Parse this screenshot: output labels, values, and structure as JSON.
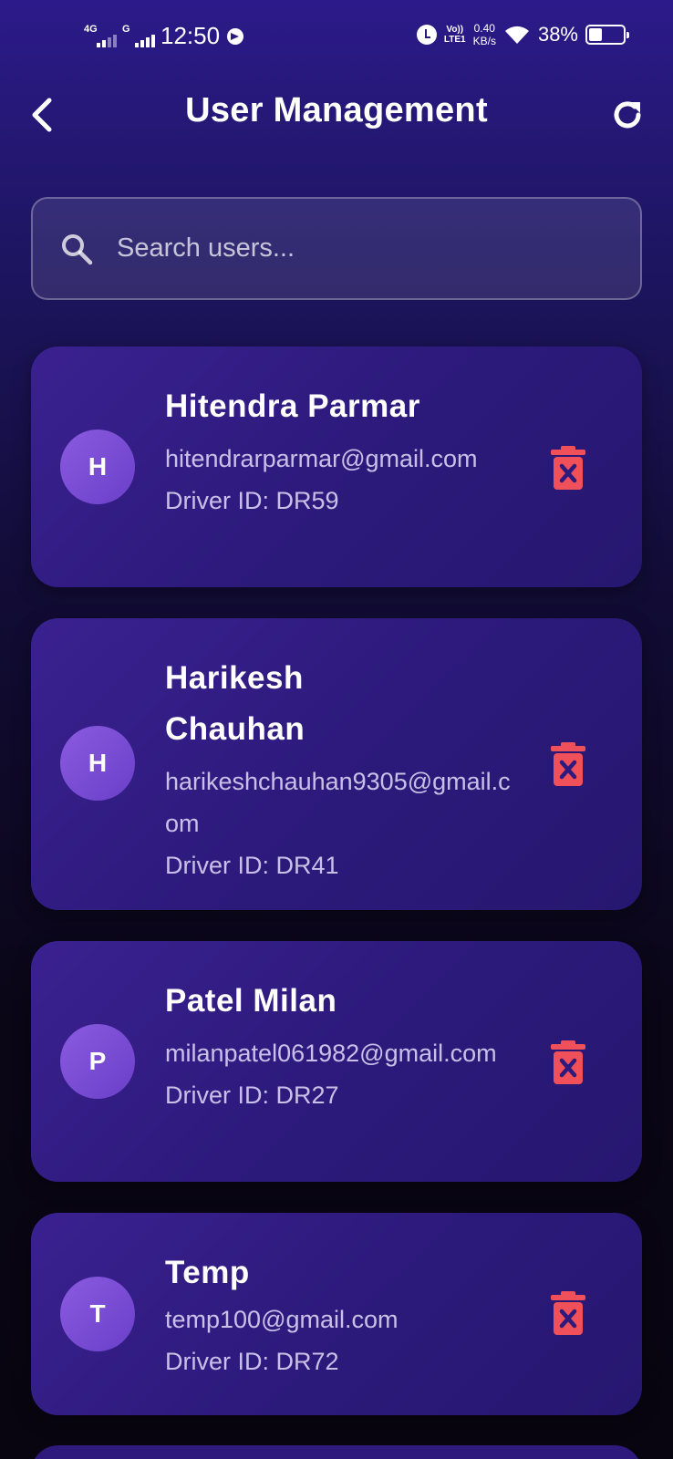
{
  "status_bar": {
    "network1": "4G",
    "network2": "G",
    "time": "12:50",
    "volte_top": "Vo))",
    "volte_bottom": "LTE1",
    "speed_value": "0.40",
    "speed_unit": "KB/s",
    "battery": "38%",
    "battery_level": 0.38
  },
  "header": {
    "title": "User Management"
  },
  "search": {
    "placeholder": "Search users..."
  },
  "users": [
    {
      "initial": "H",
      "name": "Hitendra Parmar",
      "email": "hitendrarparmar@gmail.com",
      "driver_id": "Driver ID: DR59"
    },
    {
      "initial": "H",
      "name": "Harikesh Chauhan",
      "email": "harikeshchauhan9305@gmail.com",
      "driver_id": "Driver ID: DR41"
    },
    {
      "initial": "P",
      "name": "Patel Milan",
      "email": "milanpatel061982@gmail.com",
      "driver_id": "Driver ID: DR27"
    },
    {
      "initial": "T",
      "name": "Temp",
      "email": "temp100@gmail.com",
      "driver_id": "Driver ID: DR72"
    }
  ],
  "colors": {
    "accent": "#3a2190",
    "delete": "#f0505a"
  }
}
